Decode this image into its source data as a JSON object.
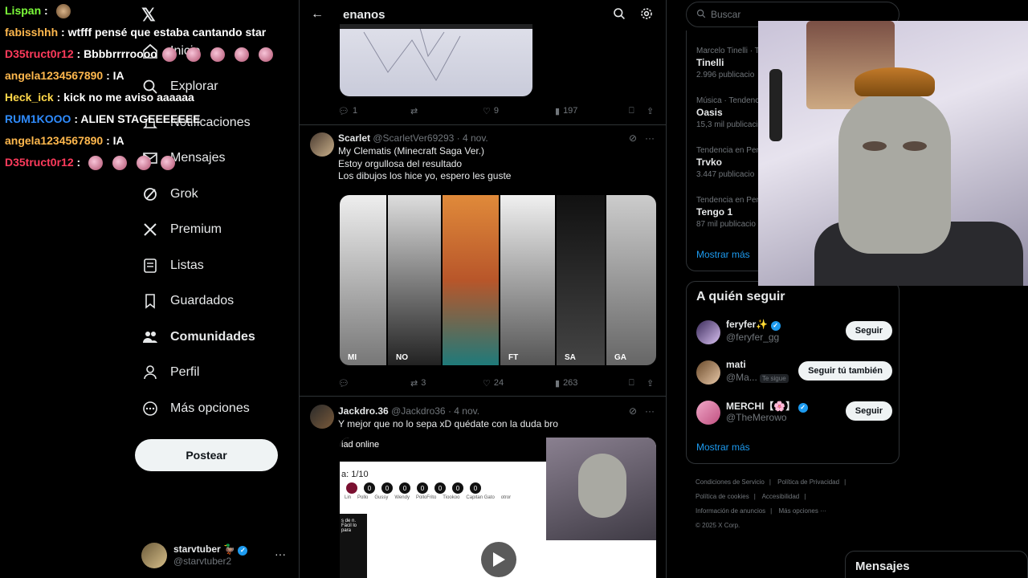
{
  "chat": [
    {
      "user": "Lispan",
      "color": "#7cfc3a",
      "msg": "",
      "emotes": 1
    },
    {
      "user": "fabisshhh",
      "color": "#ffb84d",
      "msg": "wtfff pensé que estaba cantando star",
      "emotes": 0
    },
    {
      "user": "D35truct0r12",
      "color": "#ff3b5c",
      "msg": "Bbbbrrrroooo",
      "emotes": 5
    },
    {
      "user": "angela1234567890",
      "color": "#ffb84d",
      "msg": "IA",
      "emotes": 0
    },
    {
      "user": "Heck_ick",
      "color": "#ffd84a",
      "msg": "kick no me aviso aaaaaa",
      "emotes": 0
    },
    {
      "user": "RUM1KOOO",
      "color": "#2f8cff",
      "msg": "ALIEN STAGEEEEEEE",
      "emotes": 0
    },
    {
      "user": "angela1234567890",
      "color": "#ffb84d",
      "msg": "IA",
      "emotes": 0
    },
    {
      "user": "D35truct0r12",
      "color": "#ff3b5c",
      "msg": "",
      "emotes": 4
    }
  ],
  "nav": {
    "logo": "𝕏",
    "items": [
      {
        "label": "Inicio",
        "icon": "home-icon"
      },
      {
        "label": "Explorar",
        "icon": "search-icon"
      },
      {
        "label": "Notificaciones",
        "icon": "bell-icon"
      },
      {
        "label": "Mensajes",
        "icon": "mail-icon"
      },
      {
        "label": "Grok",
        "icon": "grok-icon"
      },
      {
        "label": "Premium",
        "icon": "x-premium-icon"
      },
      {
        "label": "Listas",
        "icon": "list-icon"
      },
      {
        "label": "Guardados",
        "icon": "bookmark-icon"
      },
      {
        "label": "Comunidades",
        "icon": "communities-icon"
      },
      {
        "label": "Perfil",
        "icon": "profile-icon"
      },
      {
        "label": "Más opciones",
        "icon": "more-circle-icon"
      }
    ],
    "post_label": "Postear",
    "account": {
      "name": "starvtuber 🦆",
      "handle": "@starvtuber2",
      "more": "···"
    }
  },
  "search": {
    "query": "enanos",
    "back": "←"
  },
  "tweet0": {
    "replies": "1",
    "retweets": "",
    "likes": "9",
    "views": "197"
  },
  "tweet1": {
    "name": "Scarlet",
    "handle": "@ScarletVer69293",
    "time": "· 4 nov.",
    "lines": [
      "My Clematis (Minecraft Saga Ver.)",
      "Estoy orgullosa del resultado",
      "Los dibujos los hice yo, espero les guste"
    ],
    "panels": [
      "MI",
      "NO",
      "",
      "FT",
      "SA",
      "GA"
    ],
    "replies": "",
    "retweets": "3",
    "likes": "24",
    "views": "263"
  },
  "tweet2": {
    "name": "Jackdro.36",
    "handle": "@Jackdro36",
    "time": "· 4 nov.",
    "text": "Y mejor que no lo sepa xD quédate con la duda bro",
    "video": {
      "top": "iad online",
      "counter": "a: 1/10",
      "options": [
        "Lin",
        "Pollo",
        "Gussy",
        "Wendy",
        "PolloFrito",
        "Tiookoo",
        "Capitan Gato",
        "otror"
      ],
      "side": "s de\nn. Fácil\nlo para"
    }
  },
  "right": {
    "search_placeholder": "Buscar",
    "trends": [
      {
        "cat": "Marcelo Tinelli · T",
        "title": "Tinelli",
        "count": "2.996 publicacio"
      },
      {
        "cat": "Música · Tendenc",
        "title": "Oasis",
        "count": "15,3 mil publicaci"
      },
      {
        "cat": "Tendencia en Per",
        "title": "Trvko",
        "count": "3.447 publicacio"
      },
      {
        "cat": "Tendencia en Per",
        "title": "Tengo 1",
        "count": "87 mil publicacio"
      }
    ],
    "trends_more": "Mostrar más",
    "follow_title": "A quién seguir",
    "follow": [
      {
        "name": "feryfer✨",
        "handle": "@feryfer_gg",
        "badge": "",
        "button": "Seguir",
        "verified": true
      },
      {
        "name": "mati",
        "handle": "@Ma...",
        "badge": "Te sigue",
        "button": "Seguir tú también",
        "verified": false
      },
      {
        "name": "MERCHI【🌸】",
        "handle": "@TheMerowo",
        "badge": "",
        "button": "Seguir",
        "verified": true
      }
    ],
    "follow_more": "Mostrar más",
    "footer": [
      "Condiciones de Servicio",
      "|",
      "Política de Privacidad",
      "|",
      "Política de cookies",
      "|",
      "Accesibilidad",
      "|",
      "Información de anuncios",
      "|",
      "Más opciones ···",
      "© 2025 X Corp."
    ],
    "messages": "Mensajes"
  }
}
